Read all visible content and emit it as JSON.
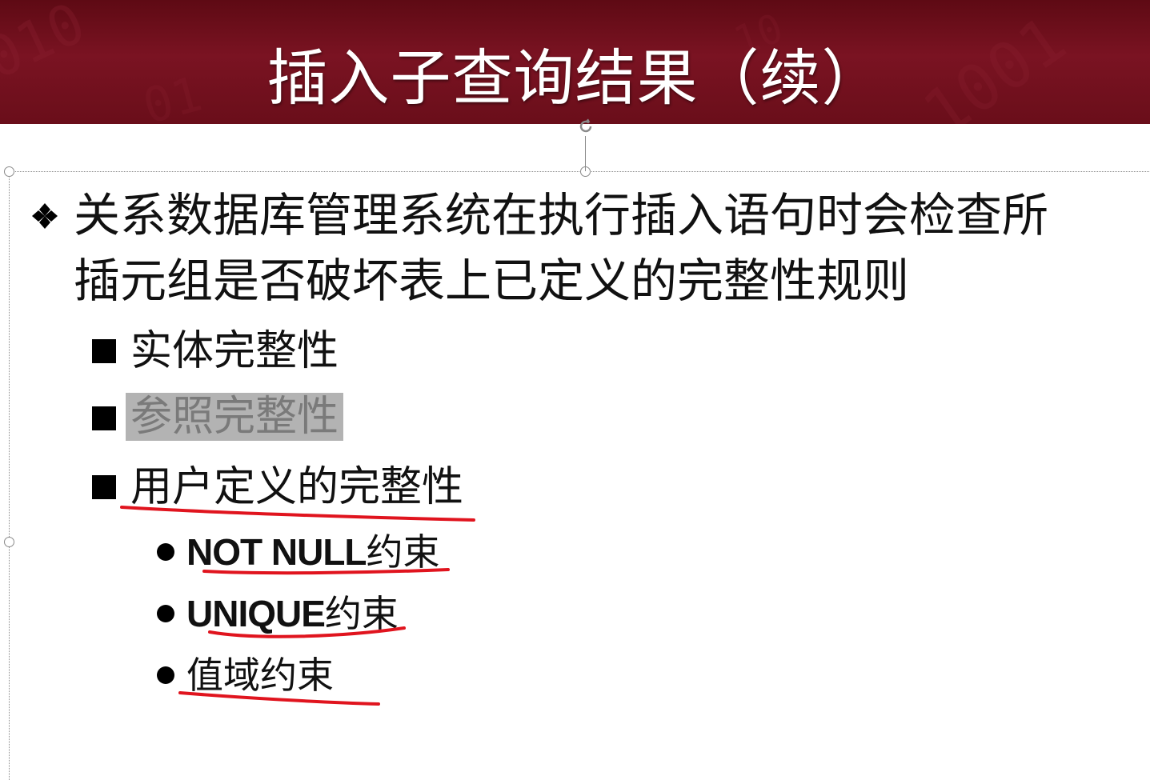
{
  "slide": {
    "title": "插入子查询结果（续）",
    "intro_line1": "关系数据库管理系统在执行插入语句时会检查所",
    "intro_line2": "插元组是否破坏表上已定义的完整性规则",
    "rules": [
      {
        "label": "实体完整性"
      },
      {
        "label": "参照完整性",
        "highlighted": true
      },
      {
        "label": "用户定义的完整性"
      }
    ],
    "constraints": [
      {
        "latin": "NOT NULL",
        "cjk": "约束"
      },
      {
        "latin": "UNIQUE",
        "cjk": "约束"
      },
      {
        "latin": "",
        "cjk": "值域约束"
      }
    ]
  },
  "colors": {
    "banner": "#6a0e1a",
    "title_text": "#ffffff",
    "body_text": "#111111",
    "highlight_bg": "#b3b3b3",
    "annotation_red": "#e0141e"
  },
  "icons": {
    "level1_bullet": "diamond-four-icon",
    "level2_bullet": "black-square-icon",
    "level3_bullet": "black-dot-icon",
    "rotate_handle": "rotate-icon"
  }
}
